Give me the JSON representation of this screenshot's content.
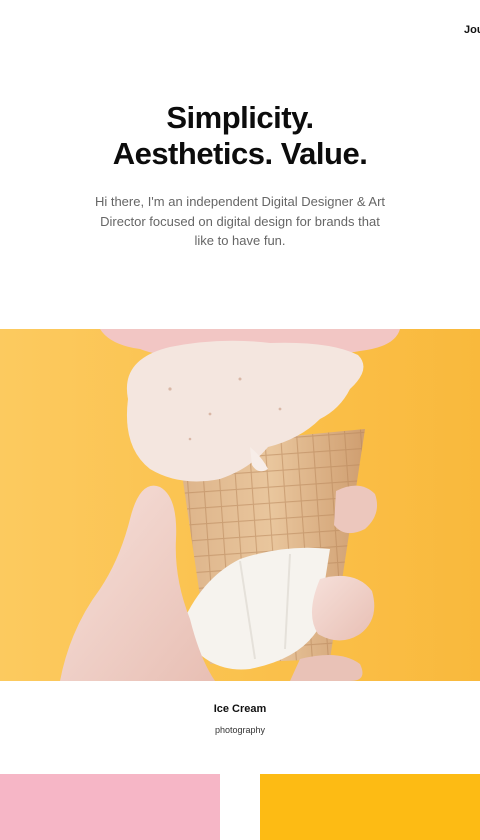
{
  "nav": {
    "journal_label": "Jou"
  },
  "hero": {
    "title_line1": "Simplicity.",
    "title_line2": "Aesthetics. Value.",
    "intro": "Hi there, I'm an independent Digital Designer & Art Director focused on digital design for brands that like to have fun."
  },
  "projects": [
    {
      "title": "Ice Cream",
      "category": "photography",
      "image": "ice-cream-cone-photo"
    }
  ],
  "colors": {
    "background": "#ffffff",
    "text": "#0c0c0c",
    "muted_text": "#666666",
    "yellow": "#fbc351",
    "pink_tile": "#f6b6c6",
    "yellow_tile": "#fdbb14"
  }
}
